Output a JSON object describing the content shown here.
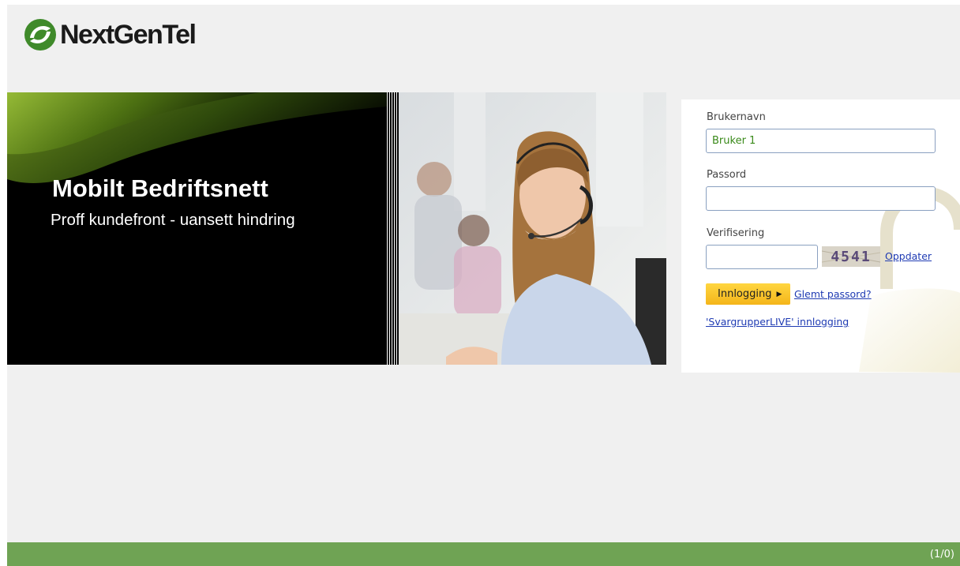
{
  "brand": {
    "logo_text": "NextGenTel",
    "logo_icon": "nextgentel-swirl-icon",
    "green": "#3f8a2a"
  },
  "banner": {
    "title": "Mobilt Bedriftsnett",
    "subtitle": "Proff kundefront - uansett hindring",
    "photo": "customer-service-headset-photo"
  },
  "login": {
    "username_label": "Brukernavn",
    "username_value": "Bruker 1",
    "password_label": "Passord",
    "password_value": "",
    "verification_label": "Verifisering",
    "verification_value": "",
    "captcha_text": "4541",
    "refresh_link": "Oppdater",
    "login_button": "Innlogging",
    "login_button_icon": "play-arrow-icon",
    "forgot_link": "Glemt passord?",
    "svargrupper_link": "'SvargrupperLIVE' innlogging",
    "background_icon": "padlock-icon"
  },
  "footer": {
    "text": "(1/0)",
    "color": "#6fa354"
  }
}
